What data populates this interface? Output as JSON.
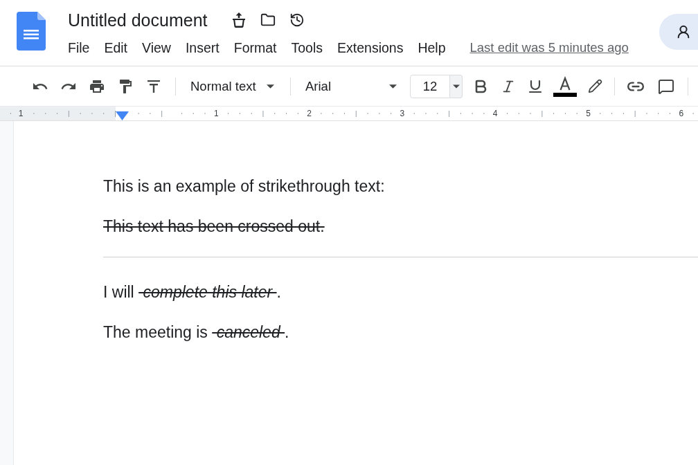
{
  "header": {
    "title": "Untitled document",
    "menu": [
      "File",
      "Edit",
      "View",
      "Insert",
      "Format",
      "Tools",
      "Extensions",
      "Help"
    ],
    "last_edit": "Last edit was 5 minutes ago"
  },
  "toolbar": {
    "paragraph_style": "Normal text",
    "font": "Arial",
    "font_size": "12"
  },
  "ruler": {
    "labels": [
      "1",
      "1",
      "2",
      "3",
      "4",
      "5",
      "6"
    ]
  },
  "document": {
    "blocks": [
      {
        "kind": "paragraph",
        "segments": [
          {
            "text": "This is an example of strikethrough text:",
            "struck": false,
            "italic": false
          }
        ]
      },
      {
        "kind": "paragraph",
        "segments": [
          {
            "text": "This text has been crossed out.",
            "struck": true,
            "italic": false
          }
        ]
      },
      {
        "kind": "rule"
      },
      {
        "kind": "paragraph",
        "segments": [
          {
            "text": "I will ",
            "struck": false,
            "italic": false
          },
          {
            "text": " complete this later ",
            "struck": true,
            "italic": true
          },
          {
            "text": ".",
            "struck": false,
            "italic": false
          }
        ]
      },
      {
        "kind": "paragraph",
        "segments": [
          {
            "text": "The meeting is ",
            "struck": false,
            "italic": false
          },
          {
            "text": " canceled ",
            "struck": true,
            "italic": true
          },
          {
            "text": ".",
            "struck": false,
            "italic": false
          }
        ]
      }
    ]
  }
}
